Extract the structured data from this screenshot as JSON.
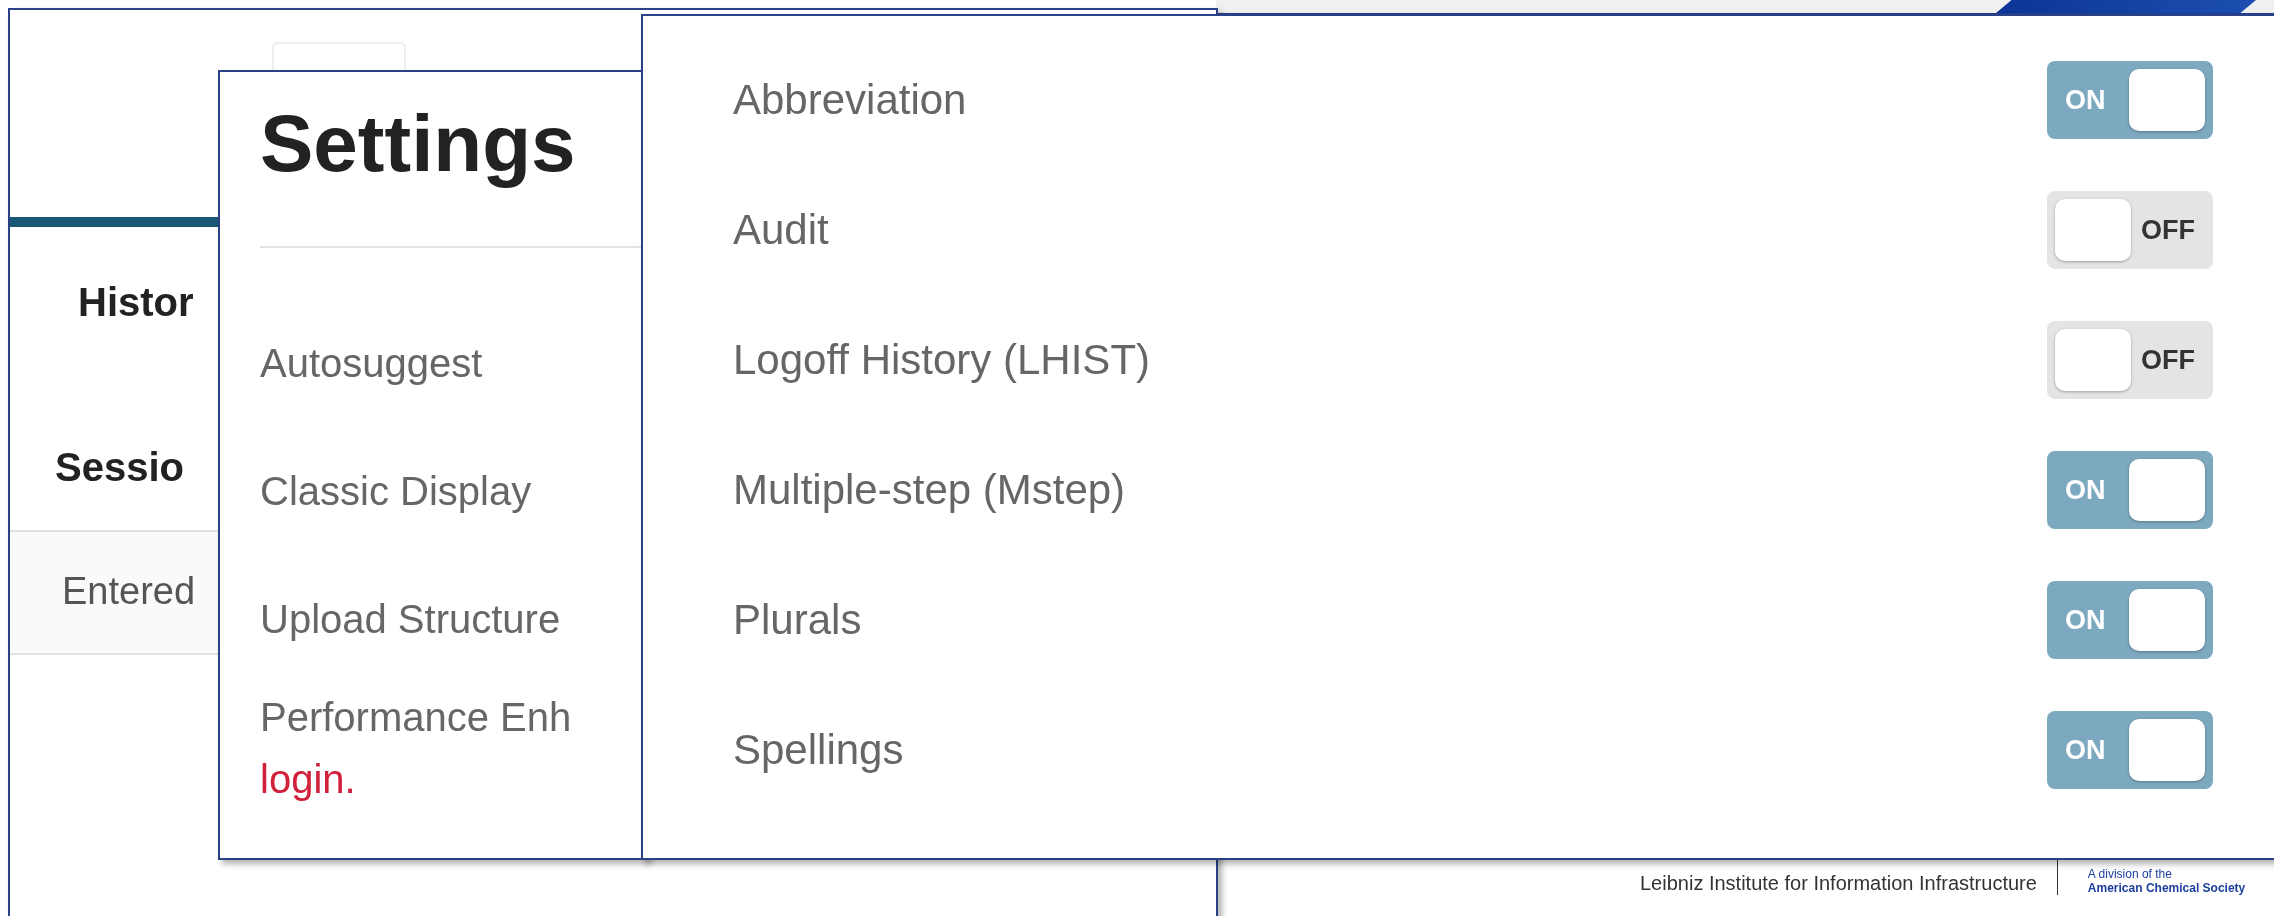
{
  "background_page": {
    "institute": "Leibniz Institute for Information Infrastructure",
    "division_line_1": "A division of the",
    "division_line_2": "American Chemical Society"
  },
  "history_page": {
    "heading": "Histor",
    "section": "Sessio",
    "column_1": "Entered"
  },
  "settings_panel": {
    "title": "Settings",
    "items": [
      {
        "label": "Autosuggest"
      },
      {
        "label": "Classic Display"
      },
      {
        "label": "Upload Structure"
      }
    ],
    "note": "Performance Enh",
    "note_link": "login."
  },
  "options_panel": {
    "options": [
      {
        "label": "Abbreviation",
        "on": true,
        "state_label": "ON"
      },
      {
        "label": "Audit",
        "on": false,
        "state_label": "OFF"
      },
      {
        "label": "Logoff History (LHIST)",
        "on": false,
        "state_label": "OFF"
      },
      {
        "label": "Multiple-step (Mstep)",
        "on": true,
        "state_label": "ON"
      },
      {
        "label": "Plurals",
        "on": true,
        "state_label": "ON"
      },
      {
        "label": "Spellings",
        "on": true,
        "state_label": "ON"
      }
    ]
  }
}
